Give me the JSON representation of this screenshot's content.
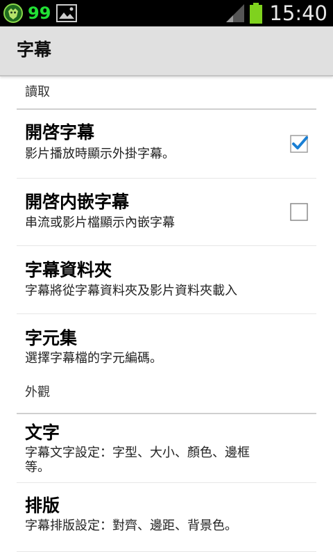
{
  "status_bar": {
    "battery_percent": "99",
    "time": "15:40",
    "icons": [
      "lion-app-icon",
      "gallery-icon",
      "signal-icon",
      "battery-icon"
    ],
    "colors": {
      "battery_text": "#22e035",
      "battery_fill": "#7fd21e"
    }
  },
  "action_bar": {
    "title": "字幕"
  },
  "categories": [
    {
      "label": "讀取"
    },
    {
      "label": "外觀"
    }
  ],
  "items": [
    {
      "title": "開啓字幕",
      "summary": "影片播放時顯示外掛字幕。",
      "checkbox": true,
      "checked": true
    },
    {
      "title": "開啓内嵌字幕",
      "summary": "串流或影片檔顯示內嵌字幕",
      "checkbox": true,
      "checked": false
    },
    {
      "title": "字幕資料夾",
      "summary": "字幕將從字幕資料夾及影片資料夾載入"
    },
    {
      "title": "字元集",
      "summary": "選擇字幕檔的字元編碼。"
    },
    {
      "title": "文字",
      "summary_line1": "字幕文字設定：字型、大小、顏色、邊框",
      "summary_line2": "等。"
    },
    {
      "title": "排版",
      "summary": "字幕排版設定：對齊、邊距、背景色。"
    }
  ],
  "accent_color": "#1a7fd4"
}
